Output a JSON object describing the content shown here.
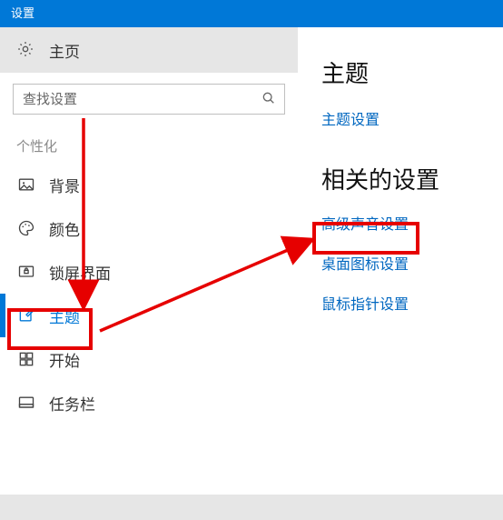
{
  "window": {
    "title": "设置"
  },
  "sidebar": {
    "home": "主页",
    "search_placeholder": "查找设置",
    "category": "个性化",
    "items": [
      {
        "label": "背景"
      },
      {
        "label": "颜色"
      },
      {
        "label": "锁屏界面"
      },
      {
        "label": "主题"
      },
      {
        "label": "开始"
      },
      {
        "label": "任务栏"
      }
    ]
  },
  "content": {
    "heading": "主题",
    "theme_settings": "主题设置",
    "related_heading": "相关的设置",
    "links": [
      "高级声音设置",
      "桌面图标设置",
      "鼠标指针设置"
    ]
  }
}
